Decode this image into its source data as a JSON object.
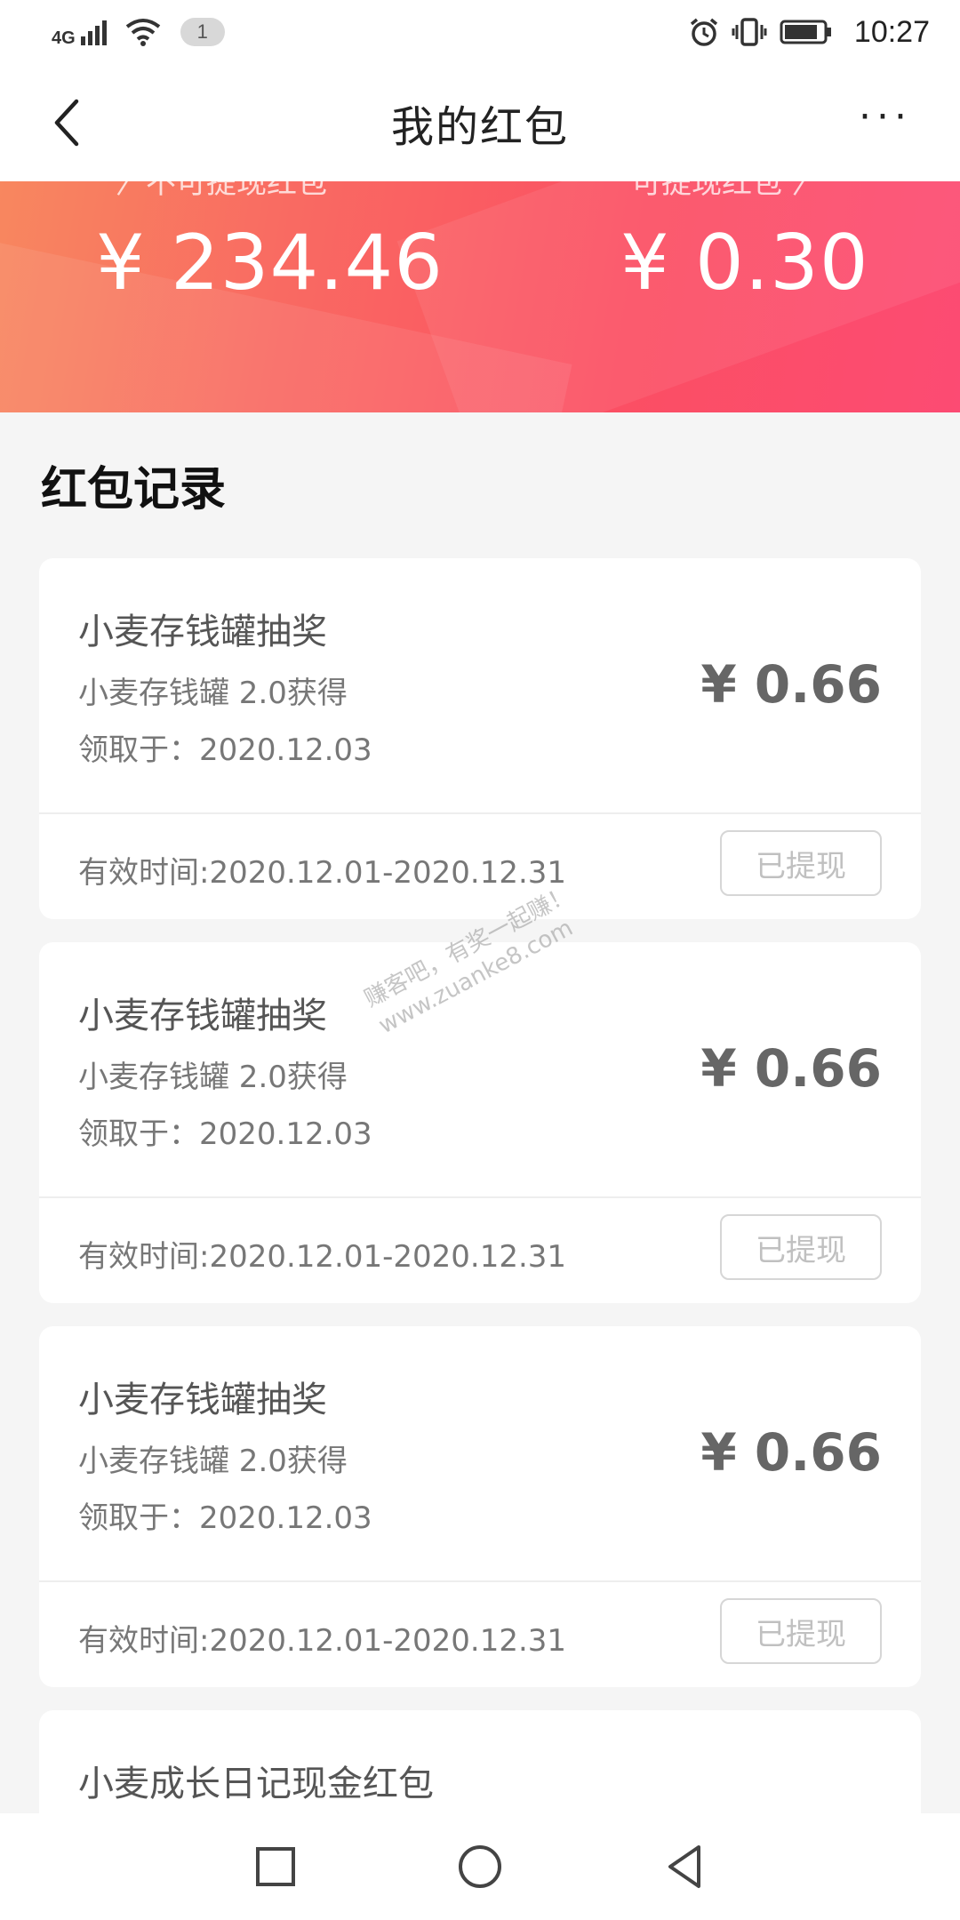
{
  "status_bar": {
    "network": "4G",
    "notification_count": "1",
    "time": "10:27"
  },
  "header": {
    "title": "我的红包",
    "more_label": "···"
  },
  "banner": {
    "left_label": "〉不可提现红包",
    "left_amount": "¥ 234.46",
    "right_label": "可提现红包 〉",
    "right_amount": "¥ 0.30"
  },
  "section": {
    "title": "红包记录"
  },
  "records": [
    {
      "title": "小麦存钱罐抽奖",
      "source": "小麦存钱罐 2.0获得",
      "claim_label": "领取于：",
      "claim_date": "2020.12.03",
      "amount": "¥ 0.66",
      "validity": "有效时间:2020.12.01-2020.12.31",
      "status": "已提现"
    },
    {
      "title": "小麦存钱罐抽奖",
      "source": "小麦存钱罐 2.0获得",
      "claim_label": "领取于：",
      "claim_date": "2020.12.03",
      "amount": "¥ 0.66",
      "validity": "有效时间:2020.12.01-2020.12.31",
      "status": "已提现"
    },
    {
      "title": "小麦存钱罐抽奖",
      "source": "小麦存钱罐 2.0获得",
      "claim_label": "领取于：",
      "claim_date": "2020.12.03",
      "amount": "¥ 0.66",
      "validity": "有效时间:2020.12.01-2020.12.31",
      "status": "已提现"
    },
    {
      "title": "小麦成长日记现金红包"
    }
  ],
  "watermark": {
    "line1": "赚客吧，有奖一起赚！",
    "line2": "www.zuanke8.com"
  },
  "colors": {
    "banner_start": "#f8875f",
    "banner_end": "#fc4b73",
    "page_bg": "#f5f5f5"
  }
}
